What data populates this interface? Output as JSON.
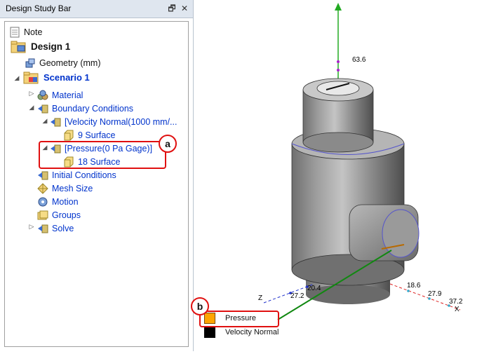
{
  "panel": {
    "title": "Design Study Bar",
    "pin_glyph": "🗗",
    "close_glyph": "✕"
  },
  "tree": {
    "note": "Note",
    "design": "Design 1",
    "geometry": "Geometry (mm)",
    "scenario": "Scenario 1",
    "material": "Material",
    "boundary_conditions": "Boundary Conditions",
    "velocity_bc": "[Velocity Normal(1000 mm/...",
    "velocity_surface": "9 Surface",
    "pressure_bc": "[Pressure(0 Pa Gage)]",
    "pressure_surface": "18 Surface",
    "initial_conditions": "Initial Conditions",
    "mesh_size": "Mesh Size",
    "motion": "Motion",
    "groups": "Groups",
    "solve": "Solve"
  },
  "callouts": {
    "a": "a",
    "b": "b"
  },
  "axes": {
    "y_value": "63.6",
    "z_label": "Z",
    "z_values": [
      "20.4",
      "27.2"
    ],
    "x_values": [
      "18.6",
      "27.9",
      "37.2"
    ],
    "x_label": "X",
    "y_color": "#22aa22",
    "x_color": "#dd2222",
    "z_color": "#2233cc"
  },
  "legend": {
    "pressure": "Pressure",
    "pressure_color": "#ffa500",
    "velocity": "Velocity Normal",
    "velocity_color": "#000000"
  },
  "colors": {
    "callout": "#e01010",
    "leader_line": "#118811",
    "tree_link": "#0033cc"
  }
}
